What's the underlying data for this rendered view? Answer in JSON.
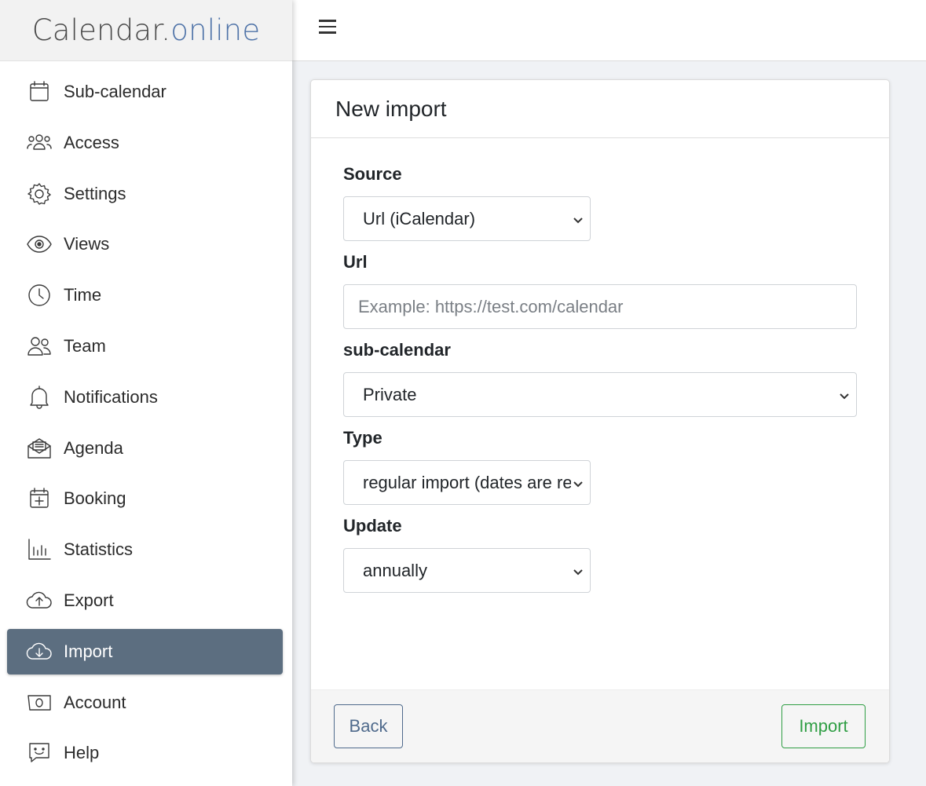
{
  "brand": {
    "name_main": "Calendar.",
    "name_accent": "online",
    "accent_color": "#4f73a8"
  },
  "sidebar": {
    "active_color": "#5c6e80",
    "items": [
      {
        "label": "Sub-calendar",
        "icon": "calendar-icon"
      },
      {
        "label": "Access",
        "icon": "people-icon"
      },
      {
        "label": "Settings",
        "icon": "gear-icon"
      },
      {
        "label": "Views",
        "icon": "eye-icon"
      },
      {
        "label": "Time",
        "icon": "clock-icon"
      },
      {
        "label": "Team",
        "icon": "team-icon"
      },
      {
        "label": "Notifications",
        "icon": "bell-icon"
      },
      {
        "label": "Agenda",
        "icon": "envelope-icon"
      },
      {
        "label": "Booking",
        "icon": "calendar-plus-icon"
      },
      {
        "label": "Statistics",
        "icon": "bar-chart-icon"
      },
      {
        "label": "Export",
        "icon": "cloud-upload-icon"
      },
      {
        "label": "Import",
        "icon": "cloud-download-icon",
        "active": true
      },
      {
        "label": "Account",
        "icon": "cash-icon"
      },
      {
        "label": "Help",
        "icon": "chat-smile-icon"
      }
    ]
  },
  "topbar": {
    "menu_icon": "hamburger-icon"
  },
  "card": {
    "title": "New import",
    "source": {
      "label": "Source",
      "value": "Url (iCalendar)"
    },
    "url": {
      "label": "Url",
      "value": "",
      "placeholder": "Example: https://test.com/calendar"
    },
    "subcalendar": {
      "label": "sub-calendar",
      "value": "Private"
    },
    "type": {
      "label": "Type",
      "value": "regular import (dates are re"
    },
    "update": {
      "label": "Update",
      "value": "annually"
    },
    "buttons": {
      "back": "Back",
      "import": "Import"
    }
  }
}
